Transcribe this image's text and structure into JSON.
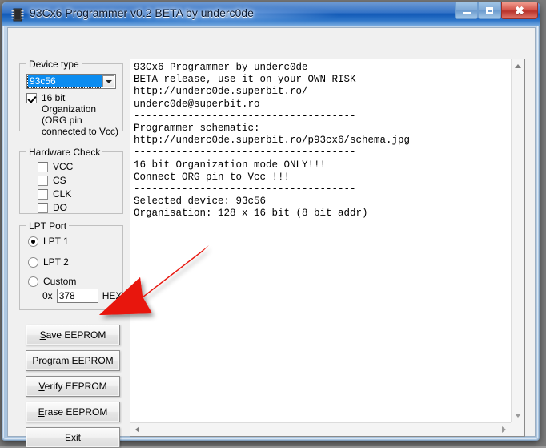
{
  "window": {
    "title": "93Cx6 Programmer v0.2 BETA by underc0de",
    "icon": "chip-icon",
    "caption_buttons": {
      "minimize": "minimize-button",
      "maximize": "maximize-button",
      "close": "close-button"
    }
  },
  "device_group": {
    "title": "Device type",
    "combo_value": "93c56",
    "org_checkbox": {
      "checked": true,
      "label": "16 bit Organization\n(ORG pin\nconnected to Vcc)"
    }
  },
  "hardware_group": {
    "title": "Hardware Check",
    "items": [
      {
        "label": "VCC",
        "checked": false
      },
      {
        "label": "CS",
        "checked": false
      },
      {
        "label": "CLK",
        "checked": false
      },
      {
        "label": "DO",
        "checked": false
      }
    ]
  },
  "lpt_group": {
    "title": "LPT Port",
    "options": [
      {
        "label": "LPT 1",
        "selected": true
      },
      {
        "label": "LPT 2",
        "selected": false
      },
      {
        "label": "Custom",
        "selected": false
      }
    ],
    "prefix_label": "0x",
    "port_value": "378",
    "suffix_label": "HEX"
  },
  "buttons": {
    "save": {
      "accel": "S",
      "rest": "ave EEPROM"
    },
    "program": {
      "accel": "P",
      "rest": "rogram EEPROM"
    },
    "verify": {
      "accel": "V",
      "rest": "erify EEPROM"
    },
    "erase": {
      "accel": "E",
      "rest": "rase EEPROM"
    },
    "exit": {
      "pre": "E",
      "accel": "x",
      "rest": "it"
    }
  },
  "log": {
    "text": "93Cx6 Programmer by underc0de\nBETA release, use it on your OWN RISK\nhttp://underc0de.superbit.ro/\nunderc0de@superbit.ro\n-------------------------------------\nProgrammer schematic:\nhttp://underc0de.superbit.ro/p93cx6/schema.jpg\n-------------------------------------\n16 bit Organization mode ONLY!!!\nConnect ORG pin to Vcc !!!\n-------------------------------------\nSelected device: 93c56\nOrganisation: 128 x 16 bit (8 bit addr)"
  },
  "annotation": {
    "arrow_color": "#e8140c",
    "points_to": "save-eeprom-button"
  },
  "colors": {
    "titlebar_blue": "#2a6cc4",
    "close_red": "#c03a2f",
    "combo_selection": "#0a8cf0",
    "client_background": "#f0f0f0"
  }
}
